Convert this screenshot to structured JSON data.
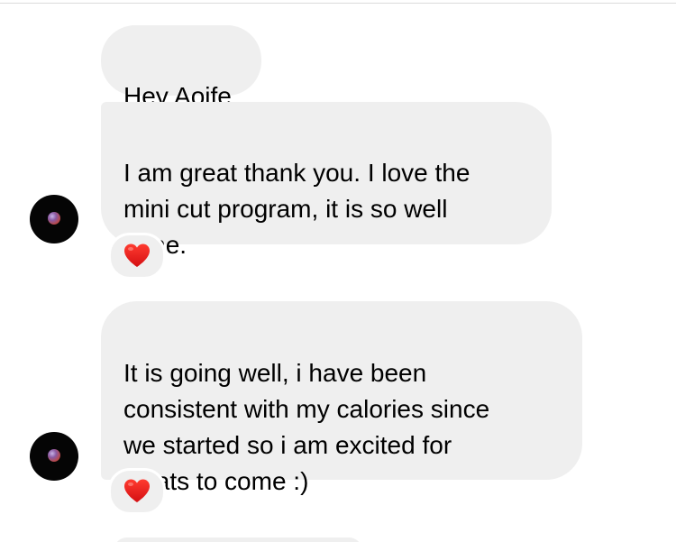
{
  "messages": [
    {
      "text": "Hey Aoife,"
    },
    {
      "text": "I am great thank you. I love the\nmini cut program, it is so well\ndone.",
      "reaction": "heart-icon"
    },
    {
      "text": "It is going well, i have been\nconsistent with my calories since\nwe started so i am excited for\nwhats to come :)",
      "reaction": "heart-icon"
    }
  ],
  "colors": {
    "bubble": "#efefef",
    "heart": "#e8201f",
    "background": "#ffffff"
  },
  "icons": {
    "avatar": "avatar-moon-icon",
    "reaction": "heart-icon"
  }
}
